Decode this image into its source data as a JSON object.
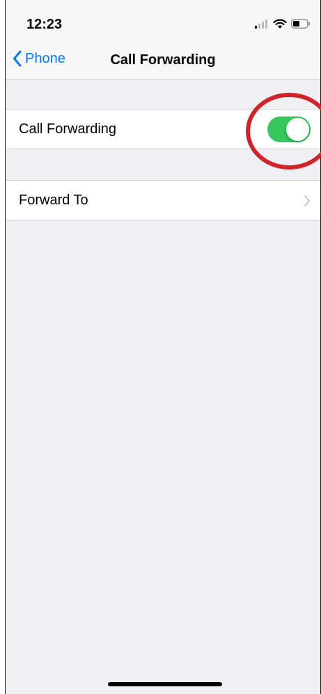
{
  "status_bar": {
    "time": "12:23",
    "icons": [
      "signal-icon",
      "wifi-icon",
      "battery-icon"
    ]
  },
  "nav": {
    "back_label": "Phone",
    "title": "Call Forwarding",
    "accent_color": "#007aff"
  },
  "settings": {
    "call_forwarding": {
      "label": "Call Forwarding",
      "enabled": true,
      "toggle_color": "#34c759"
    },
    "forward_to": {
      "label": "Forward To",
      "icon": "chevron-right-icon"
    }
  },
  "annotation": {
    "shape": "circle",
    "color": "#d2232a"
  }
}
